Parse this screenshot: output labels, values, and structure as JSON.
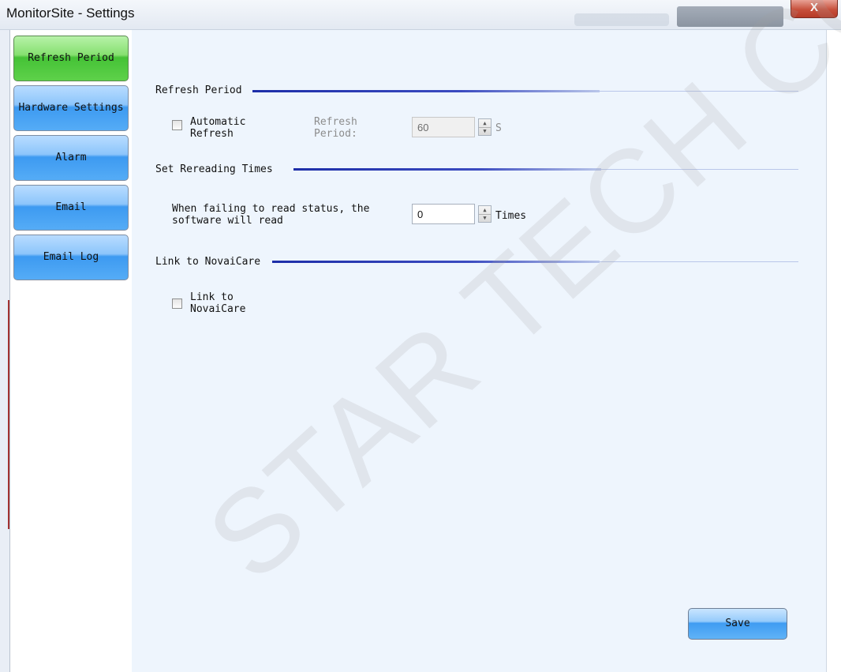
{
  "window": {
    "title": "MonitorSite - Settings",
    "close_glyph": "X"
  },
  "sidebar": {
    "items": [
      {
        "label": "Refresh Period",
        "active": true
      },
      {
        "label": "Hardware Settings",
        "active": false
      },
      {
        "label": "Alarm",
        "active": false
      },
      {
        "label": "Email",
        "active": false
      },
      {
        "label": "Email Log",
        "active": false
      }
    ]
  },
  "refresh_period": {
    "heading": "Refresh Period",
    "auto_refresh_label_line1": "Automatic",
    "auto_refresh_label_line2": "Refresh",
    "auto_refresh_checked": false,
    "period_label_line1": "Refresh",
    "period_label_line2": "Period:",
    "period_value": "60",
    "period_unit": "S"
  },
  "rereading": {
    "heading": "Set Rereading Times",
    "description_line1": "When failing to read status, the",
    "description_line2": "software will read",
    "times_value": "0",
    "times_unit": "Times"
  },
  "novaicare": {
    "heading": "Link to NovaiCare",
    "checkbox_label_line1": "Link to",
    "checkbox_label_line2": "NovaiCare",
    "checked": false
  },
  "footer": {
    "save_label": "Save"
  },
  "watermark": {
    "text": "STAR TECH CO.,LTD."
  },
  "colors": {
    "active_nav": "#5ed14a",
    "nav": "#3d9af1",
    "section_line": "#1d2ea8",
    "close": "#c7503c"
  }
}
